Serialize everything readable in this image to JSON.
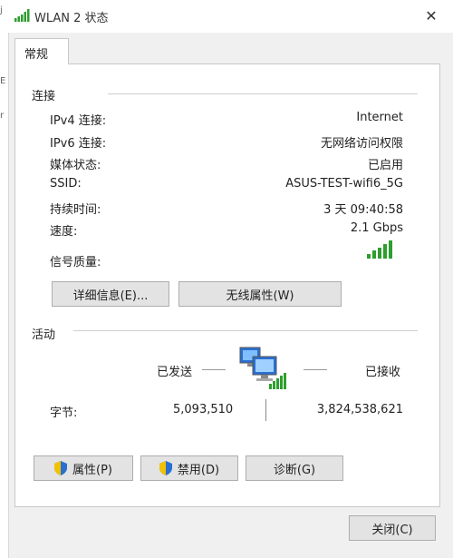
{
  "window": {
    "title": "WLAN 2 状态",
    "title_icon": "wifi-signal-icon",
    "close_glyph": "✕",
    "left_strip_chars": [
      "j",
      "E",
      "r"
    ]
  },
  "tabs": [
    {
      "label": "常规"
    }
  ],
  "connection": {
    "heading": "连接",
    "rows": [
      {
        "label": "IPv4 连接:",
        "value": "Internet"
      },
      {
        "label": "IPv6 连接:",
        "value": "无网络访问权限"
      },
      {
        "label": "媒体状态:",
        "value": "已启用"
      },
      {
        "label": "SSID:",
        "value": "ASUS-TEST-wifi6_5G"
      },
      {
        "label": "持续时间:",
        "value": "3 天 09:40:58"
      },
      {
        "label": "速度:",
        "value": "2.1 Gbps"
      }
    ],
    "signal_label": "信号质量:",
    "signal_bars": 5,
    "details_button": "详细信息(E)...",
    "wireless_props_button": "无线属性(W)"
  },
  "activity": {
    "heading": "活动",
    "sent_label": "已发送",
    "received_label": "已接收",
    "bytes_label": "字节:",
    "bytes_sent": "5,093,510",
    "bytes_received": "3,824,538,621"
  },
  "buttons": {
    "properties": "属性(P)",
    "disable": "禁用(D)",
    "diagnose": "诊断(G)",
    "close": "关闭(C)"
  },
  "colors": {
    "signal_green": "#2e9e2e",
    "shield_blue": "#2a6fd1",
    "shield_yellow": "#f2c200"
  }
}
